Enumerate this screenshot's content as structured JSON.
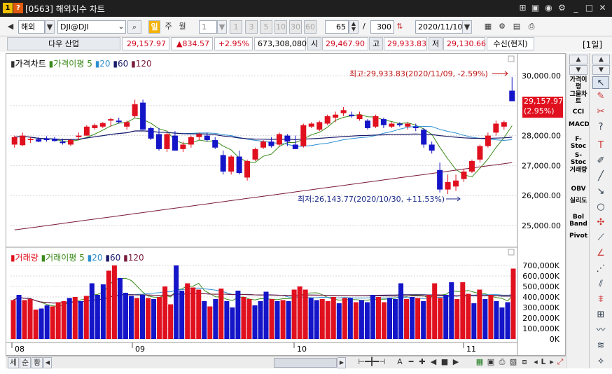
{
  "window": {
    "title": "[0563] 해외지수 차트",
    "icon1": "1",
    "icon2": "?",
    "right_icons": [
      "pin-icon",
      "save-icon",
      "camera-icon",
      "settings-icon",
      "minimize-icon",
      "maximize-icon",
      "close-icon"
    ]
  },
  "toolbar": {
    "market": "해외",
    "symbol": "DJI@DJI",
    "period_day": "일",
    "period_week": "주",
    "period_month": "월",
    "interval": "1",
    "interval_buttons": [
      "1",
      "3",
      "5",
      "10",
      "30",
      "60"
    ],
    "count": "65",
    "slash": "/",
    "total": "300",
    "date": "2020/11/10",
    "period_label": "[1일]"
  },
  "info": {
    "name": "다우 산업",
    "price": "29,157.97",
    "change": "▲834.57",
    "change_pct": "+2.95%",
    "volume": "673,308,080",
    "open_label": "시",
    "open": "29,467.90",
    "high_label": "고",
    "high": "29,933.83",
    "low_label": "저",
    "low": "29,130.66",
    "status": "수신(현지)"
  },
  "price_legend": {
    "title": "가격차트",
    "ma_title": "가격이평",
    "ma": [
      "5",
      "20",
      "60",
      "120"
    ]
  },
  "volume_legend": {
    "title": "거래량",
    "ma_title": "거래이평",
    "ma": [
      "5",
      "20",
      "60",
      "120"
    ]
  },
  "annotations": {
    "high": "최고:29,933.83(2020/11/09, -2.59%)",
    "low": "최저:26,143.77(2020/10/30, +11.53%)",
    "current_price": "29,157.97",
    "current_pct": "(2.95%)"
  },
  "x_labels": [
    "08",
    "09",
    "10",
    "11"
  ],
  "right_panel": [
    "가격이평",
    "그물차트",
    "CCI",
    "MACD",
    "F-Stoc",
    "S-Stoc",
    "거래량",
    "OBV",
    "실리도",
    "Bol Band",
    "Pivot"
  ],
  "bottom_bar": {
    "buttons": [
      "세",
      "순",
      "황"
    ]
  },
  "colors": {
    "up": "#e0101f",
    "down": "#1414c8",
    "ma5": "#3a8a1a",
    "ma20": "#2c8fd0",
    "ma60": "#1a1a6a",
    "ma120": "#7a1a3a"
  },
  "chart_data": [
    {
      "type": "candlestick",
      "title": "가격차트",
      "ylim": [
        24600,
        30400
      ],
      "yticks": [
        25000,
        26000,
        27000,
        28000,
        29000,
        30000
      ],
      "ytick_labels": [
        "25,000.00",
        "26,000.00",
        "27,000.00",
        "28,000.00",
        "29,000.00",
        "30,000.00"
      ],
      "x_labels": [
        "08",
        "09",
        "10",
        "11"
      ],
      "candles": [
        {
          "o": 27700,
          "h": 28000,
          "l": 27600,
          "c": 27950
        },
        {
          "o": 27680,
          "h": 28100,
          "l": 27650,
          "c": 28000
        },
        {
          "o": 27850,
          "h": 27950,
          "l": 27750,
          "c": 27890
        },
        {
          "o": 27880,
          "h": 27950,
          "l": 27780,
          "c": 27800
        },
        {
          "o": 27900,
          "h": 27980,
          "l": 27800,
          "c": 27850
        },
        {
          "o": 27900,
          "h": 27960,
          "l": 27800,
          "c": 27820
        },
        {
          "o": 27800,
          "h": 27900,
          "l": 27700,
          "c": 27750
        },
        {
          "o": 27700,
          "h": 27900,
          "l": 27650,
          "c": 27850
        },
        {
          "o": 27950,
          "h": 28100,
          "l": 27850,
          "c": 28000
        },
        {
          "o": 28000,
          "h": 28350,
          "l": 28000,
          "c": 28300
        },
        {
          "o": 28250,
          "h": 28400,
          "l": 28200,
          "c": 28350
        },
        {
          "o": 28300,
          "h": 28450,
          "l": 28250,
          "c": 28420
        },
        {
          "o": 28500,
          "h": 28600,
          "l": 28300,
          "c": 28550
        },
        {
          "o": 28500,
          "h": 28600,
          "l": 28400,
          "c": 28450
        },
        {
          "o": 28300,
          "h": 28500,
          "l": 28200,
          "c": 28450
        },
        {
          "o": 28650,
          "h": 29200,
          "l": 28600,
          "c": 29050
        },
        {
          "o": 29100,
          "h": 29200,
          "l": 28200,
          "c": 28200
        },
        {
          "o": 28250,
          "h": 28300,
          "l": 27850,
          "c": 27900
        },
        {
          "o": 28050,
          "h": 28250,
          "l": 27500,
          "c": 27550
        },
        {
          "o": 27550,
          "h": 28100,
          "l": 27450,
          "c": 28050
        },
        {
          "o": 28000,
          "h": 28150,
          "l": 27500,
          "c": 27500
        },
        {
          "o": 27550,
          "h": 27800,
          "l": 27450,
          "c": 27700
        },
        {
          "o": 27700,
          "h": 28000,
          "l": 27600,
          "c": 27950
        },
        {
          "o": 27950,
          "h": 28100,
          "l": 27850,
          "c": 28050
        },
        {
          "o": 28000,
          "h": 28100,
          "l": 27800,
          "c": 27850
        },
        {
          "o": 27850,
          "h": 27950,
          "l": 27550,
          "c": 27600
        },
        {
          "o": 27350,
          "h": 27500,
          "l": 26700,
          "c": 26800
        },
        {
          "o": 26800,
          "h": 27350,
          "l": 26700,
          "c": 27300
        },
        {
          "o": 27300,
          "h": 27500,
          "l": 26700,
          "c": 26750
        },
        {
          "o": 26600,
          "h": 27200,
          "l": 26500,
          "c": 27150
        },
        {
          "o": 27200,
          "h": 27600,
          "l": 27150,
          "c": 27550
        },
        {
          "o": 27600,
          "h": 27850,
          "l": 27550,
          "c": 27800
        },
        {
          "o": 27800,
          "h": 27950,
          "l": 27600,
          "c": 27650
        },
        {
          "o": 27700,
          "h": 28100,
          "l": 27650,
          "c": 28050
        },
        {
          "o": 28000,
          "h": 28050,
          "l": 27650,
          "c": 27800
        },
        {
          "o": 27700,
          "h": 28000,
          "l": 27550,
          "c": 27550
        },
        {
          "o": 27650,
          "h": 28400,
          "l": 27600,
          "c": 28350
        },
        {
          "o": 28300,
          "h": 28450,
          "l": 28250,
          "c": 28400
        },
        {
          "o": 28200,
          "h": 28500,
          "l": 28150,
          "c": 28450
        },
        {
          "o": 28400,
          "h": 28700,
          "l": 28350,
          "c": 28650
        },
        {
          "o": 28600,
          "h": 28800,
          "l": 28450,
          "c": 28700
        },
        {
          "o": 28750,
          "h": 28950,
          "l": 28650,
          "c": 28850
        },
        {
          "o": 28700,
          "h": 28800,
          "l": 28600,
          "c": 28650
        },
        {
          "o": 28550,
          "h": 28800,
          "l": 28500,
          "c": 28700
        },
        {
          "o": 28500,
          "h": 28550,
          "l": 28200,
          "c": 28250
        },
        {
          "o": 28300,
          "h": 28700,
          "l": 28250,
          "c": 28650
        },
        {
          "o": 28550,
          "h": 28600,
          "l": 28250,
          "c": 28350
        },
        {
          "o": 28300,
          "h": 28450,
          "l": 28250,
          "c": 28400
        },
        {
          "o": 28400,
          "h": 28450,
          "l": 28300,
          "c": 28350
        },
        {
          "o": 28300,
          "h": 28450,
          "l": 28200,
          "c": 28400
        },
        {
          "o": 28300,
          "h": 28400,
          "l": 28150,
          "c": 28250
        },
        {
          "o": 28200,
          "h": 28250,
          "l": 27600,
          "c": 27700
        },
        {
          "o": 27700,
          "h": 27800,
          "l": 27400,
          "c": 27500
        },
        {
          "o": 26850,
          "h": 27100,
          "l": 26100,
          "c": 26200
        },
        {
          "o": 26200,
          "h": 26700,
          "l": 26050,
          "c": 26450
        },
        {
          "o": 26300,
          "h": 26700,
          "l": 26150,
          "c": 26500
        },
        {
          "o": 26550,
          "h": 26900,
          "l": 26450,
          "c": 26800
        },
        {
          "o": 26800,
          "h": 27200,
          "l": 26750,
          "c": 27150
        },
        {
          "o": 27200,
          "h": 27700,
          "l": 27100,
          "c": 27650
        },
        {
          "o": 27650,
          "h": 28100,
          "l": 27600,
          "c": 28000
        },
        {
          "o": 28100,
          "h": 28500,
          "l": 28000,
          "c": 28400
        },
        {
          "o": 28300,
          "h": 28500,
          "l": 28200,
          "c": 28450
        },
        {
          "o": 29500,
          "h": 29950,
          "l": 29200,
          "c": 29150
        }
      ]
    },
    {
      "type": "bar",
      "title": "거래량",
      "ylim": [
        0,
        780000
      ],
      "yticks": [
        0,
        100000,
        200000,
        300000,
        400000,
        500000,
        600000,
        700000
      ],
      "ytick_labels": [
        "0K",
        "100,000K",
        "200,000K",
        "300,000K",
        "400,000K",
        "500,000K",
        "600,000K",
        "700,000K"
      ],
      "values": [
        370000,
        420000,
        370000,
        380000,
        280000,
        290000,
        320000,
        310000,
        350000,
        360000,
        390000,
        400000,
        360000,
        410000,
        530000,
        420000,
        520000,
        650000,
        700000,
        580000,
        440000,
        410000,
        390000,
        420000,
        390000,
        380000,
        400000,
        500000,
        330000,
        700000,
        460000,
        530000,
        490000,
        470000,
        360000,
        310000,
        380000,
        480000,
        360000,
        300000,
        460000,
        400000,
        380000,
        320000,
        360000,
        450000,
        380000,
        360000,
        370000,
        360000,
        470000,
        500000,
        470000,
        390000,
        370000,
        380000,
        360000,
        400000,
        340000,
        390000,
        390000,
        350000,
        370000,
        350000,
        420000,
        400000,
        350000,
        390000,
        380000,
        530000,
        380000,
        400000,
        390000,
        360000,
        420000,
        530000,
        390000,
        420000,
        540000,
        380000,
        540000,
        430000,
        340000,
        470000,
        380000,
        420000,
        360000,
        300000,
        350000,
        670000
      ]
    }
  ]
}
